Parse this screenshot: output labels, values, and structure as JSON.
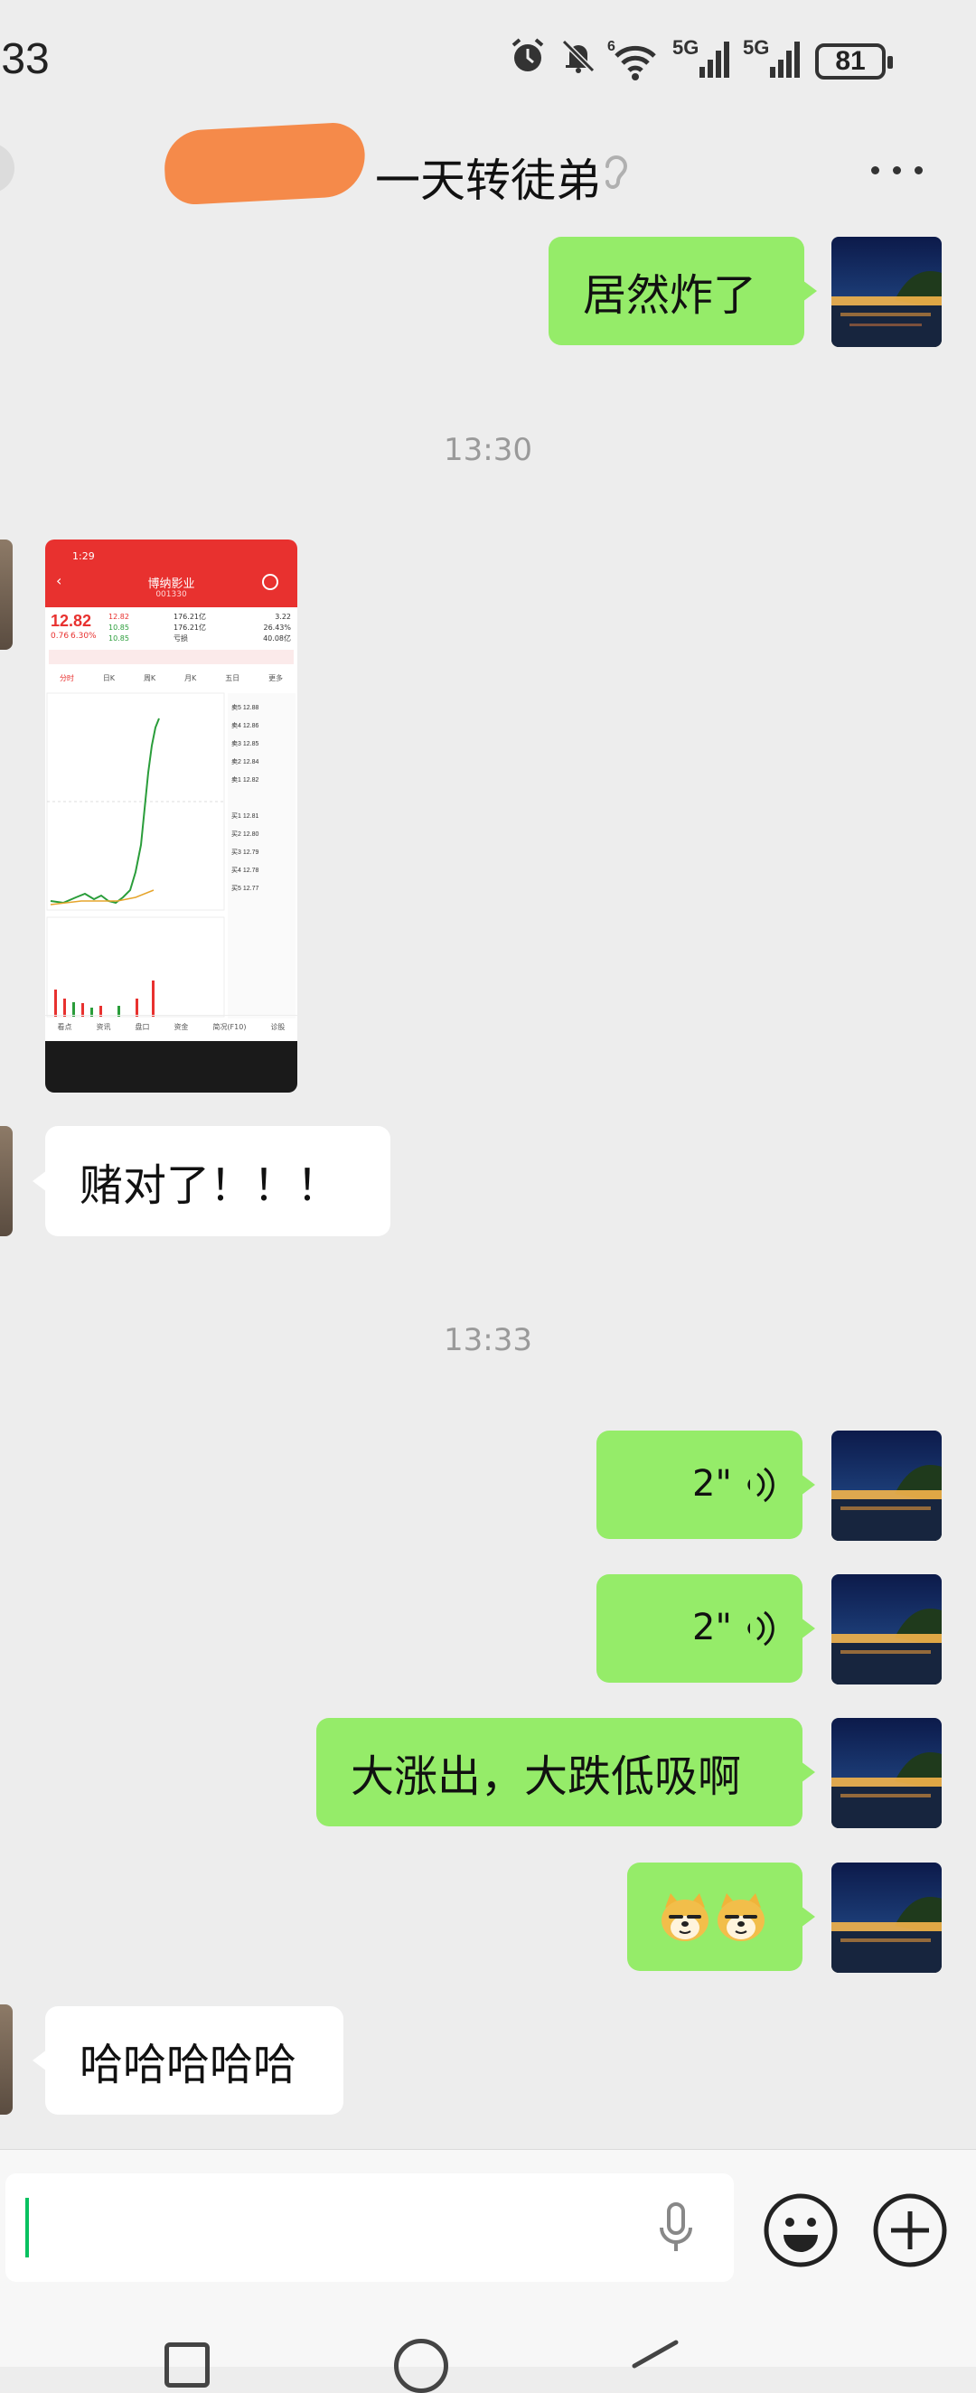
{
  "status_bar": {
    "time": ":33",
    "battery": "81"
  },
  "header": {
    "title": "一天转徒弟"
  },
  "messages": {
    "m1": {
      "text": "居然炸了"
    },
    "ts1": "13:30",
    "img": {
      "time": "1:29",
      "stock_name": "博纳影业",
      "stock_code": "001330",
      "price": "12.82",
      "change": "0.76",
      "change_pct": "6.30%",
      "high": "12.82",
      "low": "10.85",
      "open": "10.85",
      "mkt_cap": "176.21亿",
      "float_cap": "176.21亿",
      "vol_ratio": "3.22",
      "turnover": "26.43%",
      "pe": "亏损",
      "amount": "40.08亿",
      "tabs": [
        "分时",
        "日K",
        "周K",
        "月K",
        "五日",
        "更多"
      ],
      "bottom_tabs": [
        "看点",
        "资讯",
        "盘口",
        "资金",
        "简况(F10)",
        "诊股"
      ]
    },
    "m2": {
      "text": "赌对了！！！"
    },
    "ts2": "13:33",
    "v1": {
      "duration": "2\""
    },
    "v2": {
      "duration": "2\""
    },
    "m3": {
      "text": "大涨出，大跌低吸啊"
    },
    "m5": {
      "text": "哈哈哈哈哈"
    }
  },
  "colors": {
    "out_bubble": "#95ec69",
    "in_bubble": "#ffffff",
    "accent": "#07c160"
  }
}
